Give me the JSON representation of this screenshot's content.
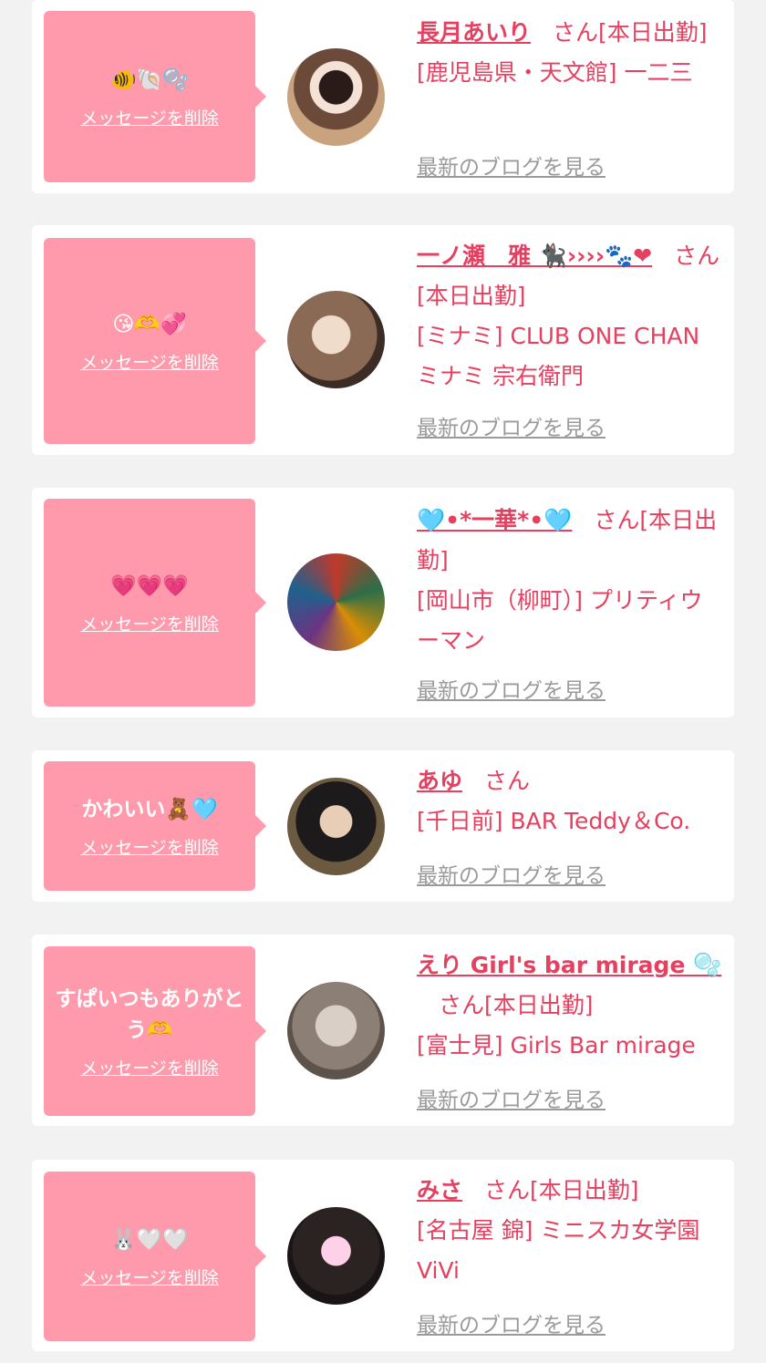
{
  "delete_label": "メッセージを削除",
  "san_label": "さん",
  "blog_label": "最新のブログを見る",
  "colors": {
    "background": "#f2f2f2",
    "bubble": "#ff9aac",
    "accent": "#e5405f",
    "link_gray": "#9a9a9a"
  },
  "cards": [
    {
      "message": "🐠🐚🫧",
      "name": "長月あいり",
      "status": "[本日出勤]",
      "shop": "[鹿児島県・天文館] 一二三"
    },
    {
      "message": "😘🫶💞",
      "name": "一ノ瀬　雅 🐈‍⬛››››🐾❤",
      "status": "[本日出勤]",
      "shop": "[ミナミ] CLUB ONE CHAN ミナミ 宗右衛門"
    },
    {
      "message": "💗💗💗",
      "name": "🩵•*一華*•🩵",
      "status": "[本日出勤]",
      "shop": "[岡山市（柳町）] プリティウーマン"
    },
    {
      "message": "かわいい🧸🩵",
      "name": "あゆ",
      "status": "",
      "shop": "[千日前] BAR Teddy＆Co."
    },
    {
      "message": "すぱいつもありがとう🫶",
      "name": "えり Girl's bar mirage 🫧",
      "status": "[本日出勤]",
      "shop": "[富士見] Girls Bar mirage"
    },
    {
      "message": "🐰🤍🤍",
      "name": "みさ",
      "status": "[本日出勤]",
      "shop": "[名古屋 錦] ミニスカ女学園ViVi"
    }
  ]
}
